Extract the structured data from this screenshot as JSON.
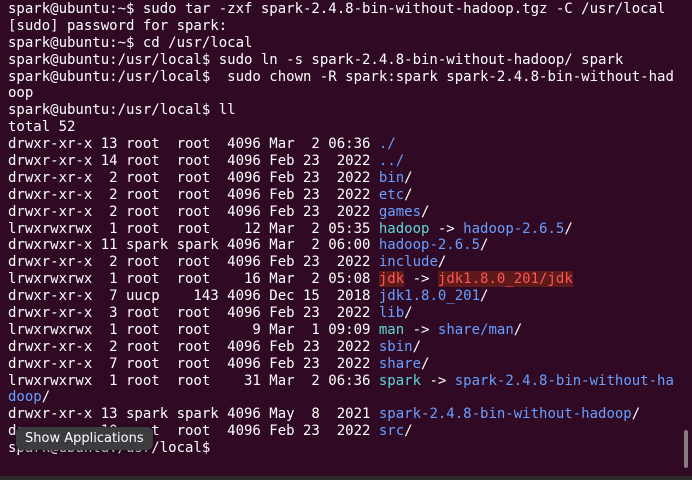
{
  "terminal": {
    "lines": [
      [
        {
          "t": "spark@ubuntu:~$ sudo tar -zxf spark-2.4.8-bin-without-hadoop.tgz -C /usr/local",
          "c": "plain"
        }
      ],
      [
        {
          "t": "[sudo] password for spark:",
          "c": "plain"
        }
      ],
      [
        {
          "t": "spark@ubuntu:~$ cd /usr/local",
          "c": "plain"
        }
      ],
      [
        {
          "t": "spark@ubuntu:/usr/local$ sudo ln -s spark-2.4.8-bin-without-hadoop/ spark",
          "c": "plain"
        }
      ],
      [
        {
          "t": "spark@ubuntu:/usr/local$  sudo chown -R spark:spark spark-2.4.8-bin-without-had",
          "c": "plain"
        }
      ],
      [
        {
          "t": "oop",
          "c": "plain"
        }
      ],
      [
        {
          "t": "spark@ubuntu:/usr/local$ ll",
          "c": "plain"
        }
      ],
      [
        {
          "t": "total 52",
          "c": "plain"
        }
      ],
      [
        {
          "t": "drwxr-xr-x 13 root  root  4096 Mar  2 06:36 ",
          "c": "plain"
        },
        {
          "t": "./",
          "c": "dir"
        }
      ],
      [
        {
          "t": "drwxr-xr-x 14 root  root  4096 Feb 23  2022 ",
          "c": "plain"
        },
        {
          "t": "../",
          "c": "dir"
        }
      ],
      [
        {
          "t": "drwxr-xr-x  2 root  root  4096 Feb 23  2022 ",
          "c": "plain"
        },
        {
          "t": "bin",
          "c": "dir"
        },
        {
          "t": "/",
          "c": "plain"
        }
      ],
      [
        {
          "t": "drwxr-xr-x  2 root  root  4096 Feb 23  2022 ",
          "c": "plain"
        },
        {
          "t": "etc",
          "c": "dir"
        },
        {
          "t": "/",
          "c": "plain"
        }
      ],
      [
        {
          "t": "drwxr-xr-x  2 root  root  4096 Feb 23  2022 ",
          "c": "plain"
        },
        {
          "t": "games",
          "c": "dir"
        },
        {
          "t": "/",
          "c": "plain"
        }
      ],
      [
        {
          "t": "lrwxrwxrwx  1 root  root    12 Mar  2 05:35 ",
          "c": "plain"
        },
        {
          "t": "hadoop",
          "c": "link"
        },
        {
          "t": " -> ",
          "c": "plain"
        },
        {
          "t": "hadoop-2.6.5",
          "c": "dir"
        },
        {
          "t": "/",
          "c": "plain"
        }
      ],
      [
        {
          "t": "drwxrwxr-x 11 spark spark 4096 Mar  2 06:00 ",
          "c": "plain"
        },
        {
          "t": "hadoop-2.6.5",
          "c": "dir"
        },
        {
          "t": "/",
          "c": "plain"
        }
      ],
      [
        {
          "t": "drwxr-xr-x  2 root  root  4096 Feb 23  2022 ",
          "c": "plain"
        },
        {
          "t": "include",
          "c": "dir"
        },
        {
          "t": "/",
          "c": "plain"
        }
      ],
      [
        {
          "t": "lrwxrwxrwx  1 root  root    16 Mar  2 05:08 ",
          "c": "plain"
        },
        {
          "t": "jdk",
          "c": "brokenLink"
        },
        {
          "t": " -> ",
          "c": "plain"
        },
        {
          "t": "jdk1.8.0_201/jdk",
          "c": "brokenTarget"
        }
      ],
      [
        {
          "t": "drwxr-xr-x  7 uucp    143 4096 Dec 15  2018 ",
          "c": "plain"
        },
        {
          "t": "jdk1.8.0_201",
          "c": "dir"
        },
        {
          "t": "/",
          "c": "plain"
        }
      ],
      [
        {
          "t": "drwxr-xr-x  3 root  root  4096 Feb 23  2022 ",
          "c": "plain"
        },
        {
          "t": "lib",
          "c": "dir"
        },
        {
          "t": "/",
          "c": "plain"
        }
      ],
      [
        {
          "t": "lrwxrwxrwx  1 root  root     9 Mar  1 09:09 ",
          "c": "plain"
        },
        {
          "t": "man",
          "c": "link"
        },
        {
          "t": " -> ",
          "c": "plain"
        },
        {
          "t": "share/man",
          "c": "dir"
        },
        {
          "t": "/",
          "c": "plain"
        }
      ],
      [
        {
          "t": "drwxr-xr-x  2 root  root  4096 Feb 23  2022 ",
          "c": "plain"
        },
        {
          "t": "sbin",
          "c": "dir"
        },
        {
          "t": "/",
          "c": "plain"
        }
      ],
      [
        {
          "t": "drwxr-xr-x  7 root  root  4096 Feb 23  2022 ",
          "c": "plain"
        },
        {
          "t": "share",
          "c": "dir"
        },
        {
          "t": "/",
          "c": "plain"
        }
      ],
      [
        {
          "t": "lrwxrwxrwx  1 root  root    31 Mar  2 06:36 ",
          "c": "plain"
        },
        {
          "t": "spark",
          "c": "link"
        },
        {
          "t": " -> ",
          "c": "plain"
        },
        {
          "t": "spark-2.4.8-bin-without-ha",
          "c": "dir"
        }
      ],
      [
        {
          "t": "doop",
          "c": "dir"
        },
        {
          "t": "/",
          "c": "plain"
        }
      ],
      [
        {
          "t": "drwxr-xr-x 13 spark spark 4096 May  8  2021 ",
          "c": "plain"
        },
        {
          "t": "spark-2.4.8-bin-without-hadoop",
          "c": "dir"
        },
        {
          "t": "/",
          "c": "plain"
        }
      ],
      [
        {
          "t": "drwxr-xr-x 10 root  root  4096 Feb 23  2022 ",
          "c": "plain"
        },
        {
          "t": "src",
          "c": "dir"
        },
        {
          "t": "/",
          "c": "plain"
        }
      ],
      [
        {
          "t": "spark@ubuntu:/usr/local$ ",
          "c": "plain"
        }
      ]
    ],
    "tooltip": "Show Applications",
    "colors": {
      "background": "#300a24",
      "dir": "#6a9fff",
      "link": "#5fd7d7",
      "broken": "#ff5555"
    }
  }
}
